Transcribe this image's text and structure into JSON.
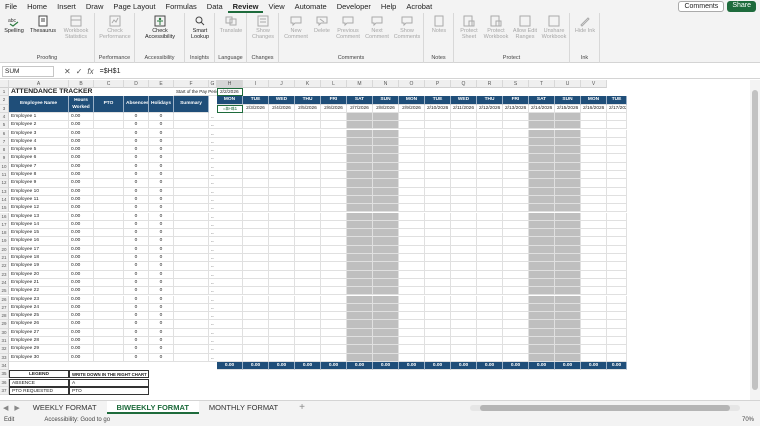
{
  "menu": [
    "File",
    "Home",
    "Insert",
    "Draw",
    "Page Layout",
    "Formulas",
    "Data",
    "Review",
    "View",
    "Automate",
    "Developer",
    "Help",
    "Acrobat"
  ],
  "active_menu": "Review",
  "comments_label": "Comments",
  "share_label": "Share",
  "ribbon": {
    "proofing": {
      "label": "Proofing",
      "spelling": "Spelling",
      "thesaurus": "Thesaurus",
      "workbook_stats": "Workbook Statistics"
    },
    "performance": {
      "label": "Performance",
      "check": "Check Performance"
    },
    "accessibility": {
      "label": "Accessibility",
      "check": "Check Accessibility"
    },
    "insights": {
      "label": "Insights",
      "smart": "Smart Lookup"
    },
    "language": {
      "label": "Language",
      "translate": "Translate"
    },
    "changes": {
      "label": "Changes",
      "show": "Show Changes"
    },
    "comments": {
      "label": "Comments",
      "new": "New Comment",
      "delete": "Delete",
      "prev": "Previous Comment",
      "next": "Next Comment",
      "show": "Show Comments"
    },
    "notes": {
      "label": "Notes",
      "notes": "Notes"
    },
    "protect": {
      "label": "Protect",
      "sheet": "Protect Sheet",
      "workbook": "Protect Workbook",
      "allow": "Allow Edit Ranges",
      "unshare": "Unshare Workbook"
    },
    "ink": {
      "label": "Ink",
      "hide": "Hide Ink"
    }
  },
  "formula_bar": {
    "name_box": "SUM",
    "formula": "=$H$1"
  },
  "columns": [
    "A",
    "B",
    "C",
    "D",
    "E",
    "F",
    "G",
    "H",
    "I",
    "J",
    "K",
    "L",
    "M",
    "N",
    "O",
    "P",
    "Q",
    "R",
    "S",
    "T",
    "U",
    "V"
  ],
  "sheet": {
    "title": "ATTENDANCE TRACKER",
    "start_label": "Start of the Pay Period:",
    "start_date": "2/2/2026",
    "left_headers": [
      "Employee Name",
      "Hours Worked",
      "PTO",
      "Absences",
      "Holidays",
      "Summary"
    ],
    "day_names": [
      "MON",
      "TUE",
      "WED",
      "THU",
      "FRI",
      "SAT",
      "SUN",
      "MON",
      "TUE",
      "WED",
      "THU",
      "FRI",
      "SAT",
      "SUN",
      "MON",
      "TUE"
    ],
    "dates": [
      "=$H$1",
      "2/3/2026",
      "2/4/2026",
      "2/5/2026",
      "2/6/2026",
      "2/7/2026",
      "2/8/2026",
      "2/9/2026",
      "2/10/2026",
      "2/11/2026",
      "2/12/2026",
      "2/13/2026",
      "2/14/2026",
      "2/15/2026",
      "2/16/2026",
      "2/17/2026"
    ],
    "employees": [
      "Employee 1",
      "Employee 2",
      "Employee 3",
      "Employee 4",
      "Employee 5",
      "Employee 6",
      "Employee 7",
      "Employee 8",
      "Employee 9",
      "Employee 10",
      "Employee 11",
      "Employee 12",
      "Employee 13",
      "Employee 14",
      "Employee 15",
      "Employee 16",
      "Employee 17",
      "Employee 18",
      "Employee 19",
      "Employee 20",
      "Employee 21",
      "Employee 22",
      "Employee 23",
      "Employee 24",
      "Employee 25",
      "Employee 26",
      "Employee 27",
      "Employee 28",
      "Employee 29",
      "Employee 30"
    ],
    "hours_value": "0.00",
    "zero_value": "0",
    "dash": "--",
    "total_value": "0.00",
    "legend_title": "LEGEND",
    "legend_note": "WRITE DOWN IN THE RIGHT CHART",
    "legend_rows": [
      [
        "ABSENCE",
        "A"
      ],
      [
        "PTO REQUESTED",
        "PTO"
      ]
    ]
  },
  "tabs": [
    "WEEKLY FORMAT",
    "BIWEEKLY FORMAT",
    "MONTHLY FORMAT"
  ],
  "active_tab": "BIWEEKLY FORMAT",
  "status": {
    "mode": "Edit",
    "accessibility": "Accessibility: Good to go",
    "zoom": "70%"
  }
}
